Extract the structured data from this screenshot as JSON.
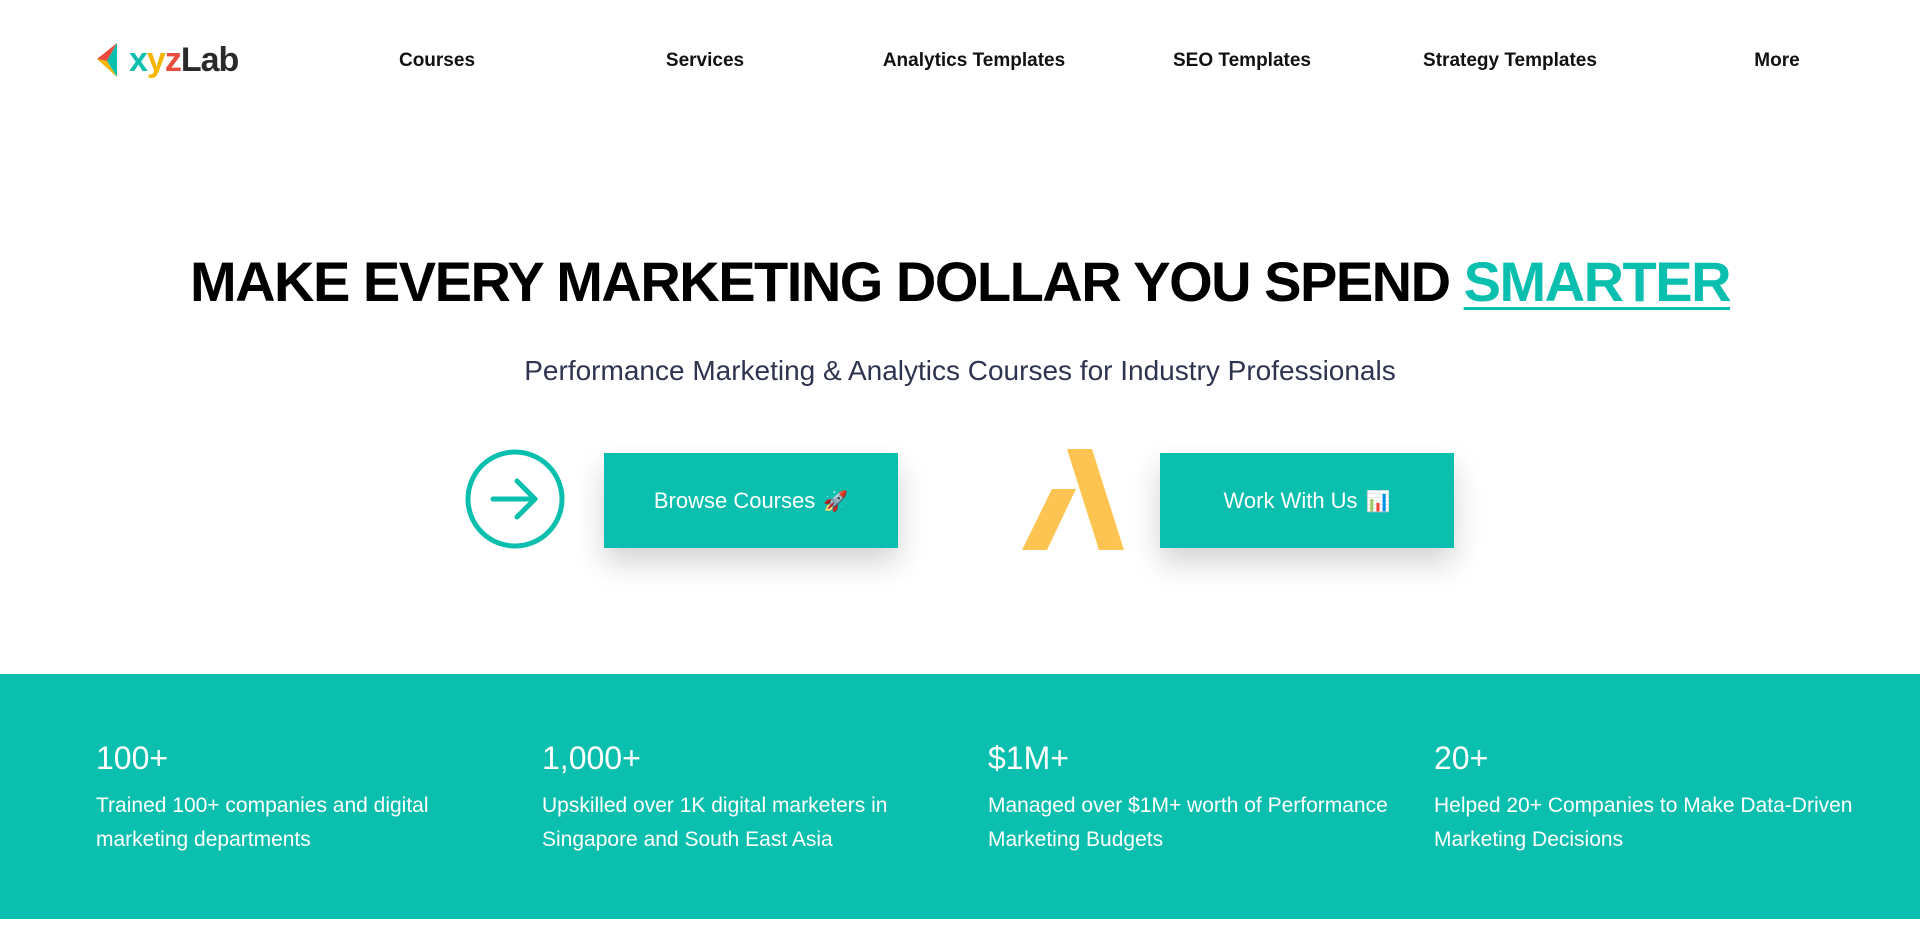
{
  "header": {
    "logo": {
      "xyz": "xyz",
      "lab": "Lab"
    },
    "nav": [
      "Courses",
      "Services",
      "Analytics Templates",
      "SEO Templates",
      "Strategy Templates",
      "More"
    ]
  },
  "hero": {
    "title_main": "MAKE EVERY MARKETING DOLLAR YOU SPEND ",
    "title_accent": "SMARTER",
    "subtitle": "Performance Marketing & Analytics Courses for Industry Professionals",
    "browse_label": "Browse Courses",
    "browse_emoji": "🚀",
    "work_label": "Work With Us",
    "work_emoji": "📊"
  },
  "stats": [
    {
      "value": "100+",
      "description": "Trained 100+ companies and digital marketing departments"
    },
    {
      "value": "1,000+",
      "description": "Upskilled over 1K digital marketers in Singapore and South East Asia"
    },
    {
      "value": "$1M+",
      "description": "Managed over $1M+ worth of Performance Marketing Budgets"
    },
    {
      "value": "20+",
      "description": "Helped 20+ Companies to Make Data-Driven Marketing Decisions"
    }
  ],
  "colors": {
    "accent": "#0bbfae",
    "ads_yellow": "#fdc452",
    "subtitle": "#2e3450"
  },
  "icons": [
    "logo-triangle-icon",
    "arrow-right-circle-icon",
    "google-ads-icon"
  ]
}
